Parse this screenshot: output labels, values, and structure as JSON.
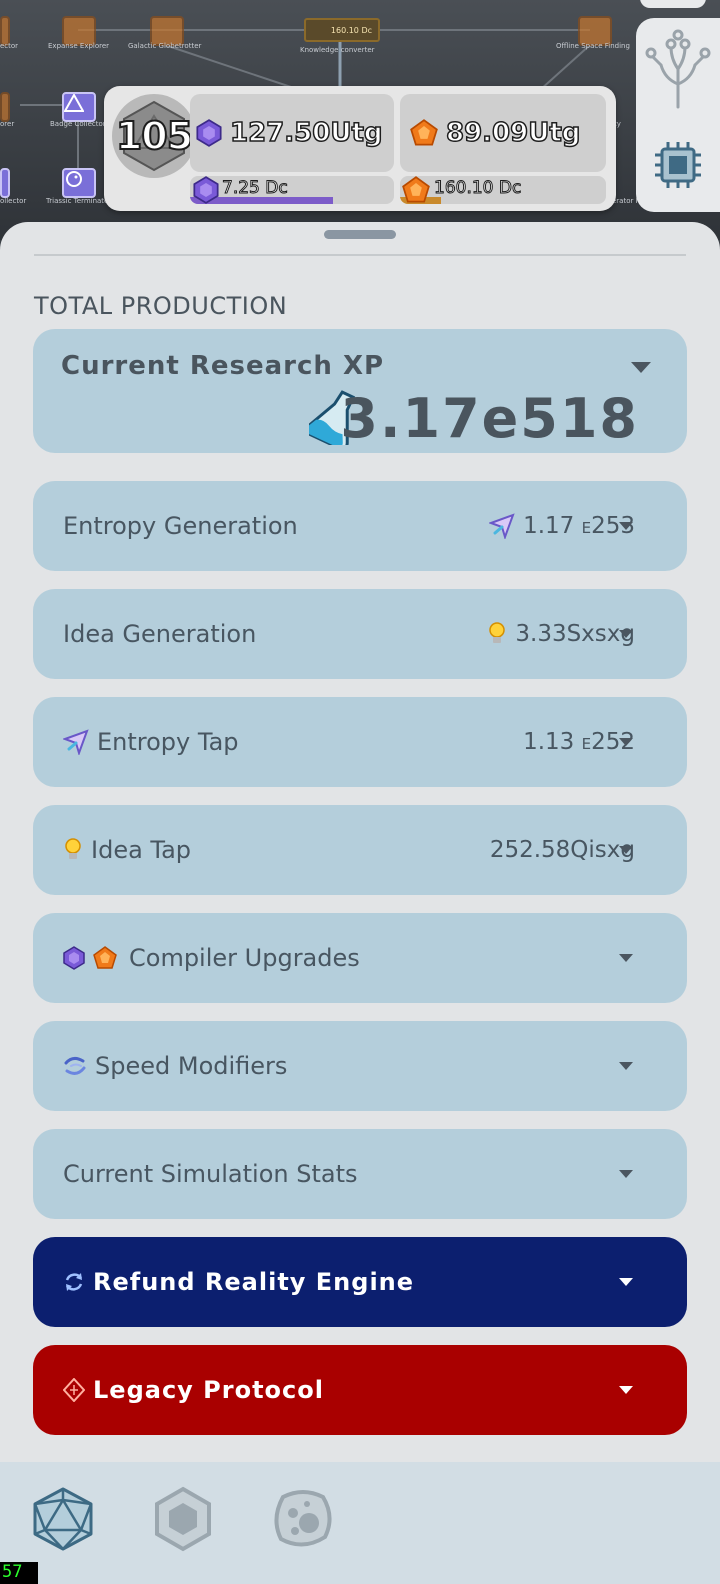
{
  "background_tree": {
    "nodes_left": [
      "Explorer",
      "Expanse Explorer",
      "Galactic Globetrotter",
      "Badge Collector",
      "Collector",
      "Triassic Terminator"
    ],
    "node_right": "Offline Space Finding",
    "node_right_2": "ity",
    "node_right_3": "erator I",
    "knowledge_value": "160.10 Dc",
    "knowledge_label": "Knowledge converter",
    "left_edge_1": "ector",
    "left_edge_2": "orer",
    "left_edge_3": "ollector"
  },
  "resources": {
    "level": "105",
    "purple_amount": "127.50Utg",
    "orange_amount": "89.09Utg",
    "purple_capacity": "7.25 Dc",
    "orange_capacity": "160.10 Dc",
    "purple_fill_fraction": 0.7,
    "orange_fill_fraction": 0.2,
    "colors": {
      "purple": "#7d5cc9",
      "orange": "#c98a2c"
    }
  },
  "right_tools": {
    "icons": [
      "tree-icon",
      "chip-icon"
    ]
  },
  "sheet": {
    "section_title": "TOTAL PRODUCTION",
    "research": {
      "label": "Current Research XP",
      "value": "3.17e518",
      "icon": "flask-icon"
    },
    "rows": [
      {
        "label": "Entropy Generation",
        "value_main": "1.17",
        "value_e": "E",
        "value_exp": "253",
        "icon": "entropy-icon"
      },
      {
        "label": "Idea Generation",
        "value": "3.33Sxsxg",
        "icon": "bulb-icon"
      },
      {
        "label": "Entropy Tap",
        "value_main": "1.13",
        "value_e": "E",
        "value_exp": "252",
        "icon": "entropy-icon"
      },
      {
        "label": "Idea Tap",
        "value": "252.58Qisxg",
        "icon": "bulb-icon"
      },
      {
        "label": "Compiler Upgrades"
      },
      {
        "label": "Speed Modifiers",
        "icon": "wave-icon"
      },
      {
        "label": "Current Simulation Stats"
      },
      {
        "label": "Refund Reality Engine",
        "icon": "refresh-icon",
        "color": "#0c1f6f"
      },
      {
        "label": "Legacy Protocol",
        "icon": "legacy-icon",
        "color": "#a90000"
      }
    ]
  },
  "bottom_nav": {
    "items": [
      "icosahedron-icon",
      "hexagon-icon",
      "cell-icon"
    ]
  },
  "fps": "57"
}
